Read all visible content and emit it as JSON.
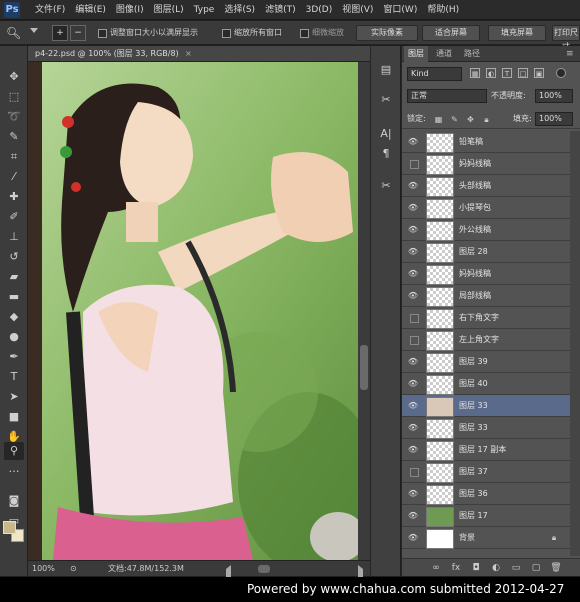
{
  "app": {
    "logo": "Ps"
  },
  "menu": [
    "文件(F)",
    "编辑(E)",
    "图像(I)",
    "图层(L)",
    "Type",
    "选择(S)",
    "滤镜(T)",
    "3D(D)",
    "视图(V)",
    "窗口(W)",
    "帮助(H)"
  ],
  "options": {
    "zoom_tool_icon": "zoom-icon",
    "resize_windows": "调整窗口大小以满屏显示",
    "zoom_all": "缩放所有窗口",
    "scrubby_zoom": "细微缩放",
    "actual_pixels": "实际像素",
    "fit_screen": "适合屏幕",
    "fill_screen": "填充屏幕",
    "print_size": "打印尺寸"
  },
  "document": {
    "tab_title": "p4-22.psd @ 100% (图层 33, RGB/8)",
    "zoom": "100%",
    "doc_info": "文档:47.8M/152.3M"
  },
  "layers_panel": {
    "tabs": [
      "图层",
      "通道",
      "路径"
    ],
    "kind": "Kind",
    "blend_mode": "正常",
    "opacity_label": "不透明度:",
    "opacity": "100%",
    "lock_label": "锁定:",
    "fill_label": "填充:",
    "fill": "100%",
    "layers": [
      {
        "name": "铅笔稿",
        "visible": true,
        "thumb": "transparent"
      },
      {
        "name": "妈妈线稿",
        "visible": false,
        "thumb": "transparent"
      },
      {
        "name": "头部线稿",
        "visible": true,
        "thumb": "transparent"
      },
      {
        "name": "小提琴包",
        "visible": true,
        "thumb": "transparent"
      },
      {
        "name": "外公线稿",
        "visible": true,
        "thumb": "transparent"
      },
      {
        "name": "图层 28",
        "visible": true,
        "thumb": "transparent"
      },
      {
        "name": "妈妈线稿",
        "visible": true,
        "thumb": "transparent"
      },
      {
        "name": "局部线稿",
        "visible": true,
        "thumb": "transparent"
      },
      {
        "name": "右下角文字",
        "visible": false,
        "thumb": "transparent"
      },
      {
        "name": "左上角文字",
        "visible": false,
        "thumb": "transparent"
      },
      {
        "name": "图层 39",
        "visible": true,
        "thumb": "transparent"
      },
      {
        "name": "图层 40",
        "visible": true,
        "thumb": "transparent"
      },
      {
        "name": "图层 33",
        "visible": true,
        "thumb": "girl",
        "selected": true
      },
      {
        "name": "图层 33",
        "visible": true,
        "thumb": "transparent"
      },
      {
        "name": "图层 17 副本",
        "visible": true,
        "thumb": "transparent"
      },
      {
        "name": "图层 37",
        "visible": false,
        "thumb": "transparent"
      },
      {
        "name": "图层 36",
        "visible": true,
        "thumb": "transparent"
      },
      {
        "name": "图层 17",
        "visible": true,
        "thumb": "green"
      },
      {
        "name": "背景",
        "visible": true,
        "thumb": "white",
        "locked": true
      }
    ]
  },
  "footer": {
    "credit": "Powered by www.chahua.com submitted 2012-04-27"
  }
}
